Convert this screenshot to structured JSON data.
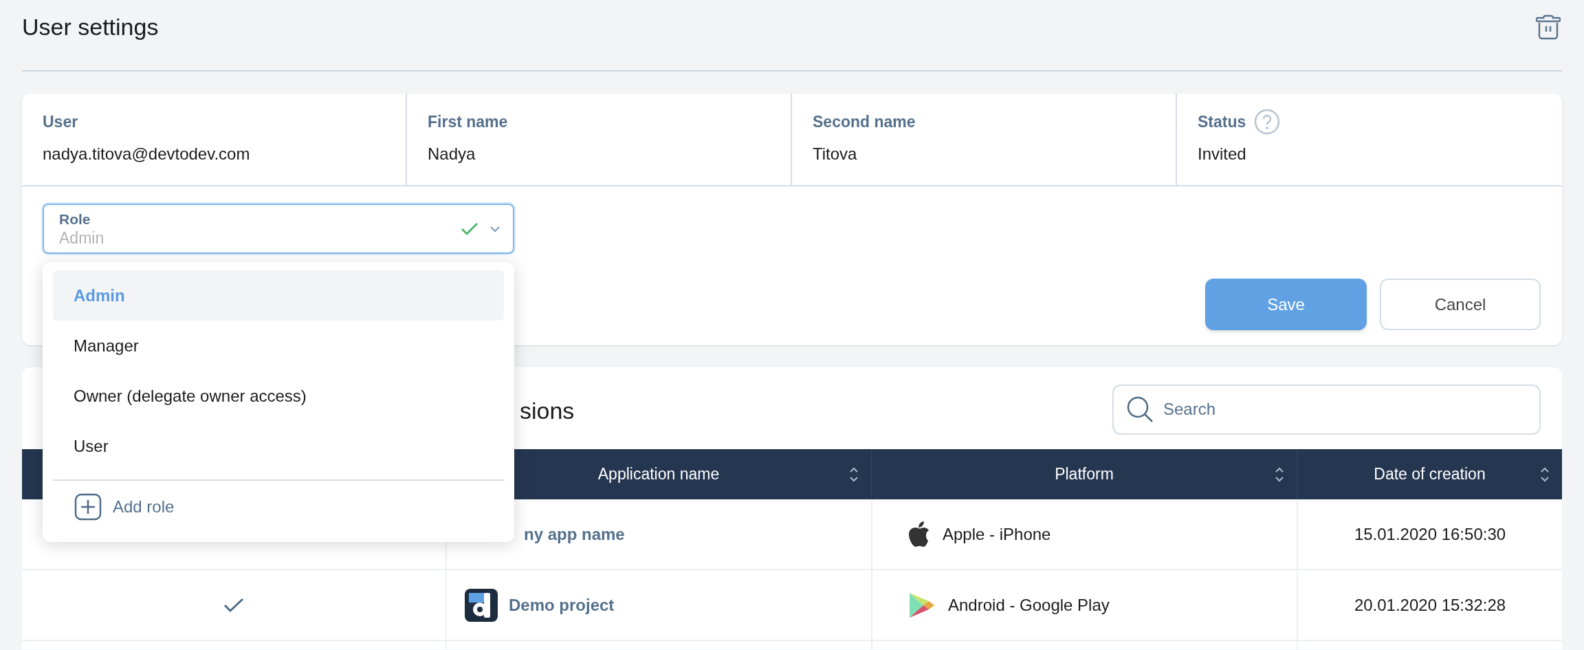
{
  "page": {
    "title": "User settings"
  },
  "user_info": [
    {
      "label": "User",
      "value": "nadya.titova@devtodev.com"
    },
    {
      "label": "First name",
      "value": "Nadya"
    },
    {
      "label": "Second name",
      "value": "Titova"
    },
    {
      "label": "Status",
      "value": "Invited",
      "help": true
    }
  ],
  "role_field": {
    "label": "Role",
    "value": "Admin",
    "valid": true,
    "options": [
      {
        "label": "Admin",
        "selected": true
      },
      {
        "label": "Manager",
        "selected": false
      },
      {
        "label": "Owner (delegate owner access)",
        "selected": false
      },
      {
        "label": "User",
        "selected": false
      }
    ],
    "add_label": "Add role"
  },
  "buttons": {
    "save": "Save",
    "cancel": "Cancel"
  },
  "permissions": {
    "title": "sions",
    "search": {
      "placeholder": "Search"
    },
    "columns": [
      "Application name",
      "Platform",
      "Date of creation"
    ],
    "rows": [
      {
        "app_name": "ny app name",
        "platform": {
          "kind": "apple",
          "name": "Apple - iPhone"
        },
        "date": "15.01.2020 16:50:30"
      },
      {
        "checked": true,
        "app_name": "Demo project",
        "app_icon": true,
        "platform": {
          "kind": "google-play",
          "name": "Android - Google Play"
        },
        "date": "20.01.2020 15:32:28"
      }
    ]
  }
}
